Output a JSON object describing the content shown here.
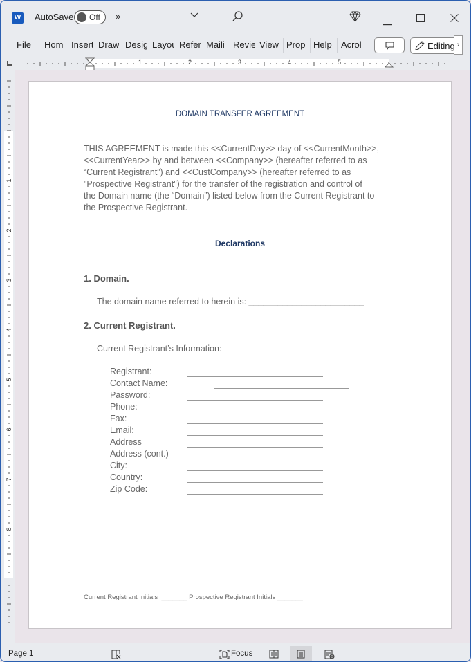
{
  "titlebar": {
    "app_icon": "word-icon",
    "app_icon_glyph": "W",
    "autosave_label": "AutoSave",
    "autosave_state": "Off",
    "more_label": "»",
    "customize_label": "⌄",
    "search_icon": "search-icon",
    "premium_icon": "diamond-icon",
    "minimize_glyph": "—",
    "maximize_glyph": "☐",
    "close_glyph": "✕"
  },
  "ribbon": {
    "tabs": [
      "File",
      "Home",
      "Insert",
      "Draw",
      "Design",
      "Layout",
      "References",
      "Mailings",
      "Review",
      "View",
      "Properties",
      "Help",
      "Acrobat"
    ],
    "tabs_visible": [
      "File",
      "Hom",
      "Insert",
      "Draw",
      "Desig",
      "Layou",
      "Refer",
      "Maili",
      "Revie",
      "View",
      "Prop",
      "Help",
      "Acrol"
    ],
    "comment_icon": "comment-icon",
    "editing_label": "Editing",
    "scroll_glyph": "›"
  },
  "ruler": {
    "h_numbers": [
      "1",
      "2",
      "3",
      "4",
      "5"
    ],
    "v_numbers": [
      "1",
      "2",
      "3",
      "4",
      "5",
      "6",
      "7",
      "8"
    ]
  },
  "document": {
    "title": "DOMAIN TRANSFER AGREEMENT",
    "intro_lines": [
      "THIS AGREEMENT is made this <<CurrentDay>> day of <<CurrentMonth>>,",
      "<<CurrentYear>> by and between <<Company>> (hereafter referred to as",
      "“Current Registrant”) and <<CustCompany>> (hereafter referred to as",
      "\"Prospective Registrant\") for the transfer of the registration and control of",
      "the Domain name (the “Domain”) listed below from the Current Registrant to",
      "the Prospective Registrant."
    ],
    "declarations_heading": "Declarations",
    "section1_heading": "1. Domain.",
    "section1_text": "The domain name referred to herein is: ________________________",
    "section2_heading": "2. Current Registrant.",
    "section2_subheading": "Current Registrant’s Information:",
    "fields": [
      {
        "label": "Registrant:",
        "offset": "short"
      },
      {
        "label": "Contact Name:",
        "offset": "long"
      },
      {
        "label": "Password:",
        "offset": "short"
      },
      {
        "label": "Phone:",
        "offset": "long"
      },
      {
        "label": "Fax:",
        "offset": "short"
      },
      {
        "label": "Email:",
        "offset": "short"
      },
      {
        "label": "Address",
        "offset": "short"
      },
      {
        "label": "Address (cont.)",
        "offset": "long"
      },
      {
        "label": "City:",
        "offset": "short"
      },
      {
        "label": "Country:",
        "offset": "short"
      },
      {
        "label": "Zip Code:",
        "offset": "short"
      }
    ],
    "footer_text": "Current Registrant Initials  _______ Prospective Registrant Initials _______"
  },
  "statusbar": {
    "page_label": "Page 1",
    "proofing_icon": "proofing-icon",
    "focus_label": "Focus",
    "read_mode_icon": "read-mode-icon",
    "print_layout_icon": "print-layout-icon",
    "web_layout_icon": "web-layout-icon"
  }
}
